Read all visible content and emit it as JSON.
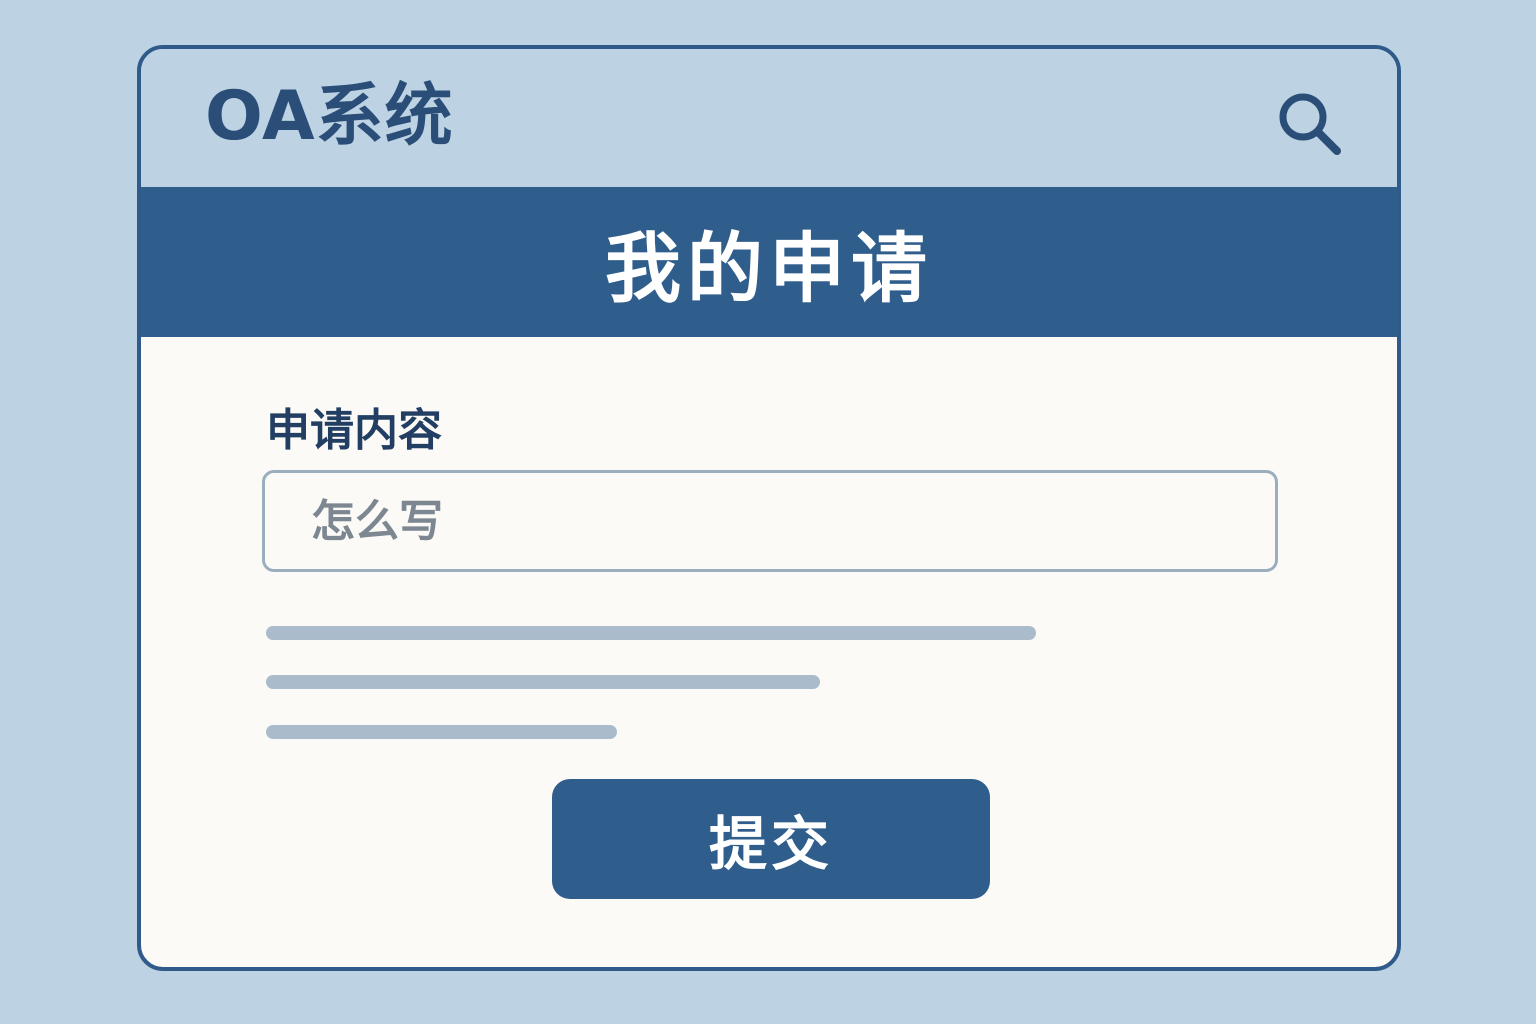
{
  "header": {
    "app_title": "OA系统",
    "search_icon": "search-icon"
  },
  "banner": {
    "title": "我的申请"
  },
  "form": {
    "content_label": "申请内容",
    "content_input": {
      "value": "",
      "placeholder": "怎么写"
    },
    "submit_label": "提交"
  },
  "colors": {
    "background": "#bdd2e3",
    "primary": "#2f5d8c",
    "panel": "#fbfaf7",
    "label_text": "#223f63",
    "placeholder_text": "#7d8791",
    "skeleton": "#aabccb"
  }
}
